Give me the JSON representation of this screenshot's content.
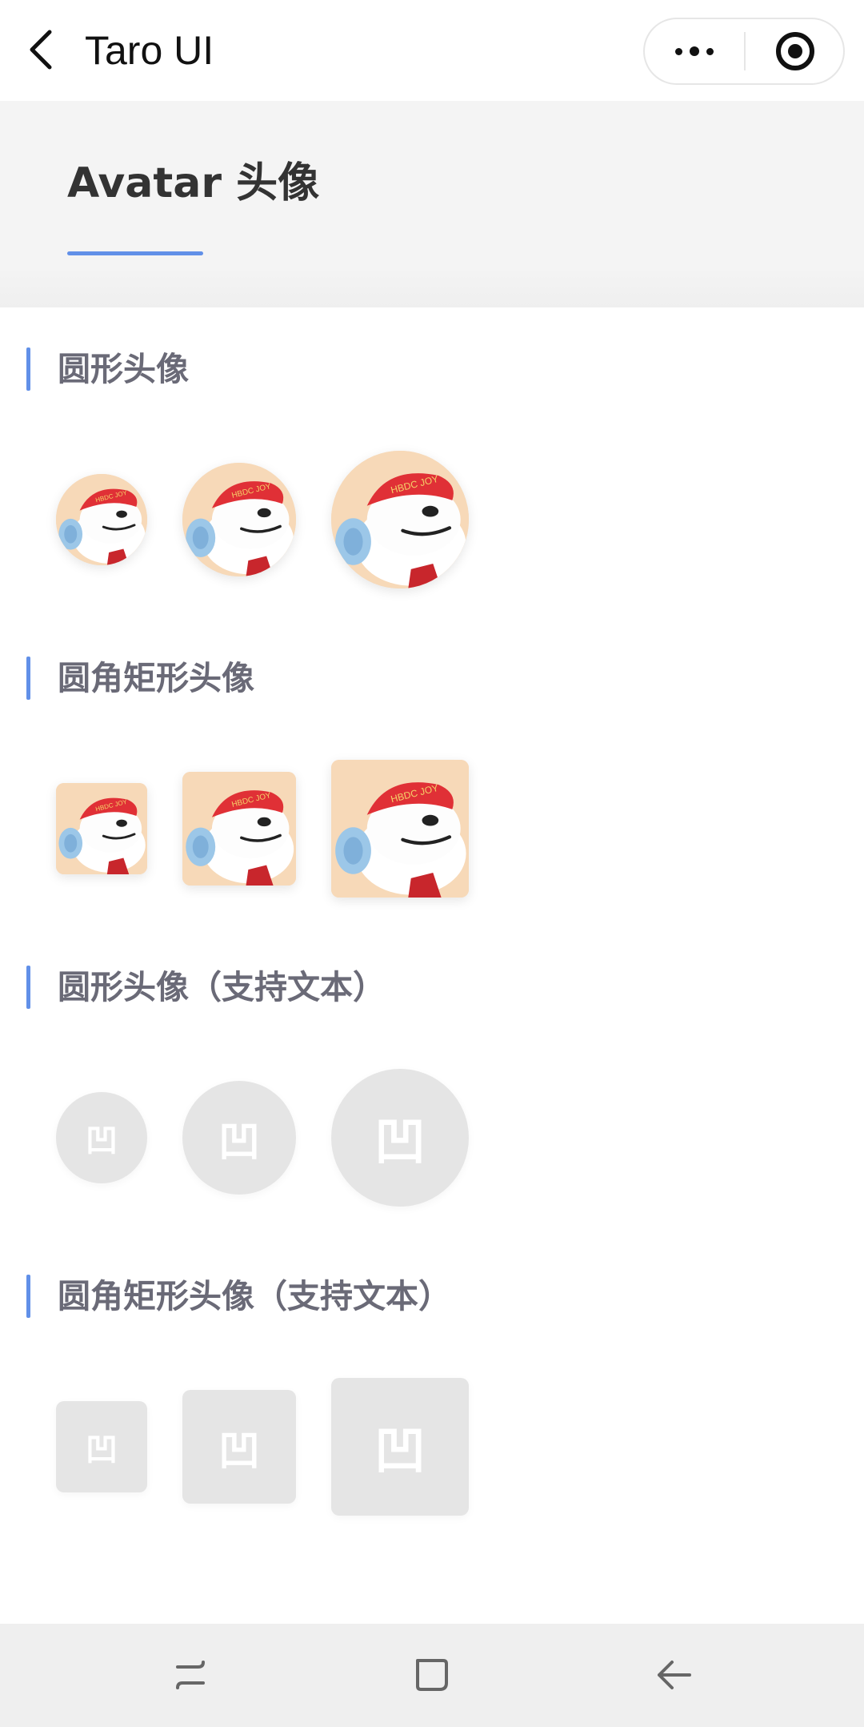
{
  "topbar": {
    "title": "Taro UI",
    "icons": {
      "back": "chevron-left-icon",
      "more": "more-dots-icon",
      "close": "target-circle-icon"
    }
  },
  "header": {
    "title": "Avatar 头像",
    "accent_color": "#6190e8"
  },
  "sections": [
    {
      "title": "圆形头像",
      "shape": "circle",
      "type": "image"
    },
    {
      "title": "圆角矩形头像",
      "shape": "rounded",
      "type": "image"
    },
    {
      "title": "圆形头像（支持文本）",
      "shape": "circle",
      "type": "text",
      "text": "凹"
    },
    {
      "title": "圆角矩形头像（支持文本）",
      "shape": "rounded",
      "type": "text",
      "text": "凹"
    }
  ],
  "avatar_sizes": [
    "small",
    "normal",
    "large"
  ],
  "avatar_image_label": "HBDC JOY",
  "colors": {
    "text_avatar_bg": "#e5e5e5",
    "section_title": "#6a6a77"
  },
  "navbar": {
    "icons": [
      "recent-apps-icon",
      "home-icon",
      "back-arrow-icon"
    ]
  }
}
